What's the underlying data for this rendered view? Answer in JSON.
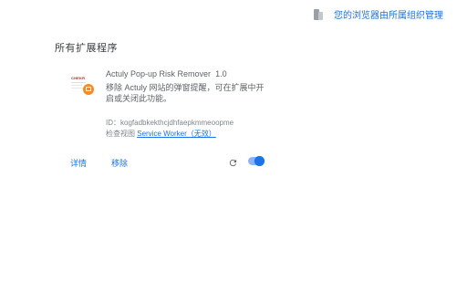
{
  "policy": {
    "text": "",
    "link_text": "您的浏览器由所属组织管理"
  },
  "section": {
    "title": "所有扩展程序"
  },
  "extension": {
    "logo_text": "CHEKR",
    "name": "Actuly Pop-up Risk Remover",
    "version": "1.0",
    "description": "移除 Actuly 网站的弹窗提醒，可在扩展中开启或关闭此功能。",
    "id_label": "ID：",
    "id_value": "kogfadbkekthcjdhfaepkmmeoopme",
    "views_label": "检查视图",
    "views_link": "Service Worker（无效）",
    "details_label": "详情",
    "remove_label": "移除",
    "enabled": true
  },
  "colors": {
    "accent": "#1a73e8",
    "toggle_track": "#8ab4f8",
    "logo_badge": "#f28b2c"
  }
}
